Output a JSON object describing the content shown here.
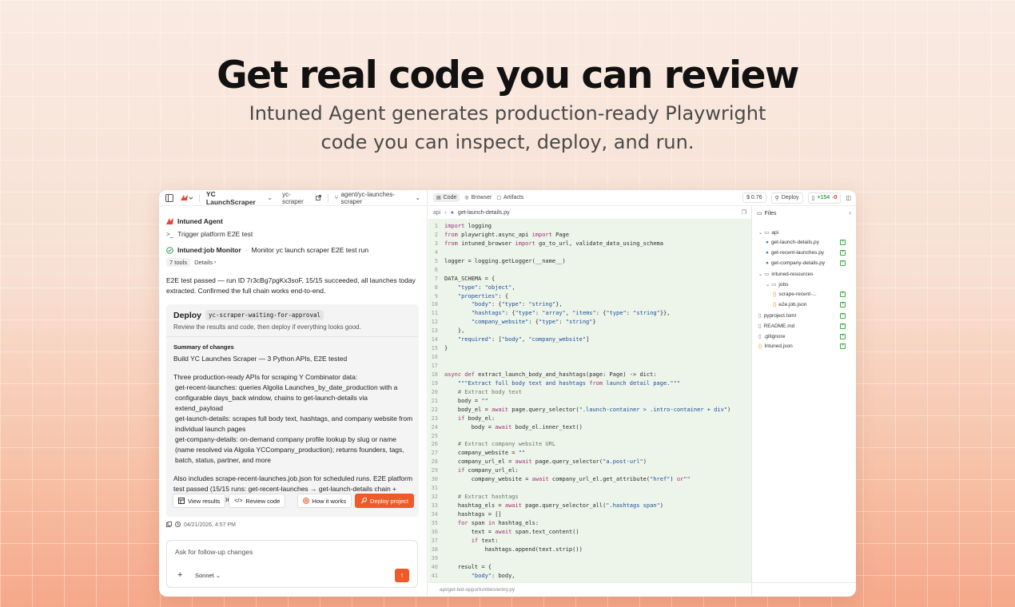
{
  "hero": {
    "title": "Get real code you can review",
    "subtitle": "Intuned Agent generates production-ready Playwright code you can inspect, deploy, and run."
  },
  "topbar": {
    "project": "YC LaunchScraper",
    "repo": "yc-scraper",
    "branch": "agent/yc-launches-scraper"
  },
  "chat": {
    "agent_name": "Intuned Agent",
    "trigger": "Trigger platform E2E test",
    "job_title": "Intuned:job Monitor",
    "job_desc": "Monitor yc launch scraper E2E test run",
    "tools_count": "7 tools",
    "details": "Details",
    "result_text": "E2E test passed — run ID 7r3cBg7pgKx3soF, 15/15 succeeded, all launches today extracted. Confirmed the full chain works end-to-end.",
    "deploy": {
      "title": "Deploy",
      "tag": "yc-scraper-waiting-for-approval",
      "desc": "Review the results and code, then deploy if everything looks good.",
      "summary_heading": "Summary of changes",
      "summary_line": "Build YC Launches Scraper — 3 Python APIs, E2E tested",
      "body1": "Three production-ready APIs for scraping Y Combinator data:",
      "bullet1": "get-recent-launches: queries Algolia Launches_by_date_production with a configurable days_back window, chains to get-launch-details via extend_payload",
      "bullet2": "get-launch-details: scrapes full body text, hashtags, and company website from individual launch pages",
      "bullet3": "get-company-details: on-demand company profile lookup by slug or name (name resolved via Algolia YCCompany_production); returns founders, tags, batch, status, partner, and more",
      "body2": "Also includes scrape-recent-launches.job.json for scheduled runs. E2E platform test passed (15/15 runs: get-recent-launches → get-launch-details chain + standalone get-company-details).",
      "btn_view": "View results",
      "btn_review": "Review code",
      "btn_how": "How it works",
      "btn_deploy": "Deploy project"
    },
    "timestamp": "04/21/2026, 4:57 PM",
    "composer_placeholder": "Ask for follow-up changes",
    "model": "Sonnet"
  },
  "tabs": {
    "code": "Code",
    "browser": "Browser",
    "artifacts": "Artifacts"
  },
  "actions": {
    "cost": "$ 0.76",
    "deploy": "Deploy",
    "added": "+154",
    "removed": "-0"
  },
  "editor": {
    "breadcrumb_root": "api",
    "breadcrumb_file": "get-launch-details.py",
    "lines": [
      "import logging",
      "from playwright.async_api import Page",
      "from intuned_browser import go_to_url, validate_data_using_schema",
      "",
      "logger = logging.getLogger(__name__)",
      "",
      "DATA_SCHEMA = {",
      "    \"type\": \"object\",",
      "    \"properties\": {",
      "        \"body\": {\"type\": \"string\"},",
      "        \"hashtags\": {\"type\": \"array\", \"items\": {\"type\": \"string\"}},",
      "        \"company_website\": {\"type\": \"string\"}",
      "    },",
      "    \"required\": [\"body\", \"company_website\"]",
      "}",
      "",
      "",
      "async def extract_launch_body_and_hashtags(page: Page) -> dict:",
      "    \"\"\"Extract full body text and hashtags from launch detail page.\"\"\"",
      "    # Extract body text",
      "    body = \"\"",
      "    body_el = await page.query_selector(\".launch-container > .intro-container + div\")",
      "    if body_el:",
      "        body = await body_el.inner_text()",
      "",
      "    # Extract company website URL",
      "    company_website = \"\"",
      "    company_url_el = await page.query_selector(\"a.post-url\")",
      "    if company_url_el:",
      "        company_website = await company_url_el.get_attribute(\"href\") or\"\"",
      "",
      "    # Extract hashtags",
      "    hashtag_els = await page.query_selector_all(\".hashtags span\")",
      "    hashtags = []",
      "    for span in hashtag_els:",
      "        text = await span.text_content()",
      "        if text:",
      "            hashtags.append(text.strip())",
      "",
      "    result = {",
      "        \"body\": body,"
    ],
    "status_path": "api/get-bid-opportunities/entry.py"
  },
  "files": {
    "title": "Files",
    "items": [
      {
        "name": "api",
        "kind": "folder",
        "depth": 0,
        "added": false
      },
      {
        "name": "get-launch-details.py",
        "kind": "py",
        "depth": 1,
        "added": true
      },
      {
        "name": "get-recent-launches.py",
        "kind": "py",
        "depth": 1,
        "added": true
      },
      {
        "name": "get-company-details.py",
        "kind": "py",
        "depth": 1,
        "added": true
      },
      {
        "name": "intuned-resources",
        "kind": "folder",
        "depth": 0,
        "added": false
      },
      {
        "name": "jobs",
        "kind": "folder",
        "depth": 1,
        "added": false
      },
      {
        "name": "scrape-recent-...",
        "kind": "json",
        "depth": 2,
        "added": true
      },
      {
        "name": "e2e.job.json",
        "kind": "json",
        "depth": 2,
        "added": true
      },
      {
        "name": "pyproject.toml",
        "kind": "file",
        "depth": 0,
        "added": true
      },
      {
        "name": "README.md",
        "kind": "file",
        "depth": 0,
        "added": true
      },
      {
        "name": ".gitignore",
        "kind": "file",
        "depth": 0,
        "added": true
      },
      {
        "name": "Intuned.json",
        "kind": "json",
        "depth": 0,
        "added": true
      }
    ]
  },
  "colors": {
    "accent": "#f05a28",
    "added": "#3fa84a",
    "code_bg": "#edf4ea"
  }
}
